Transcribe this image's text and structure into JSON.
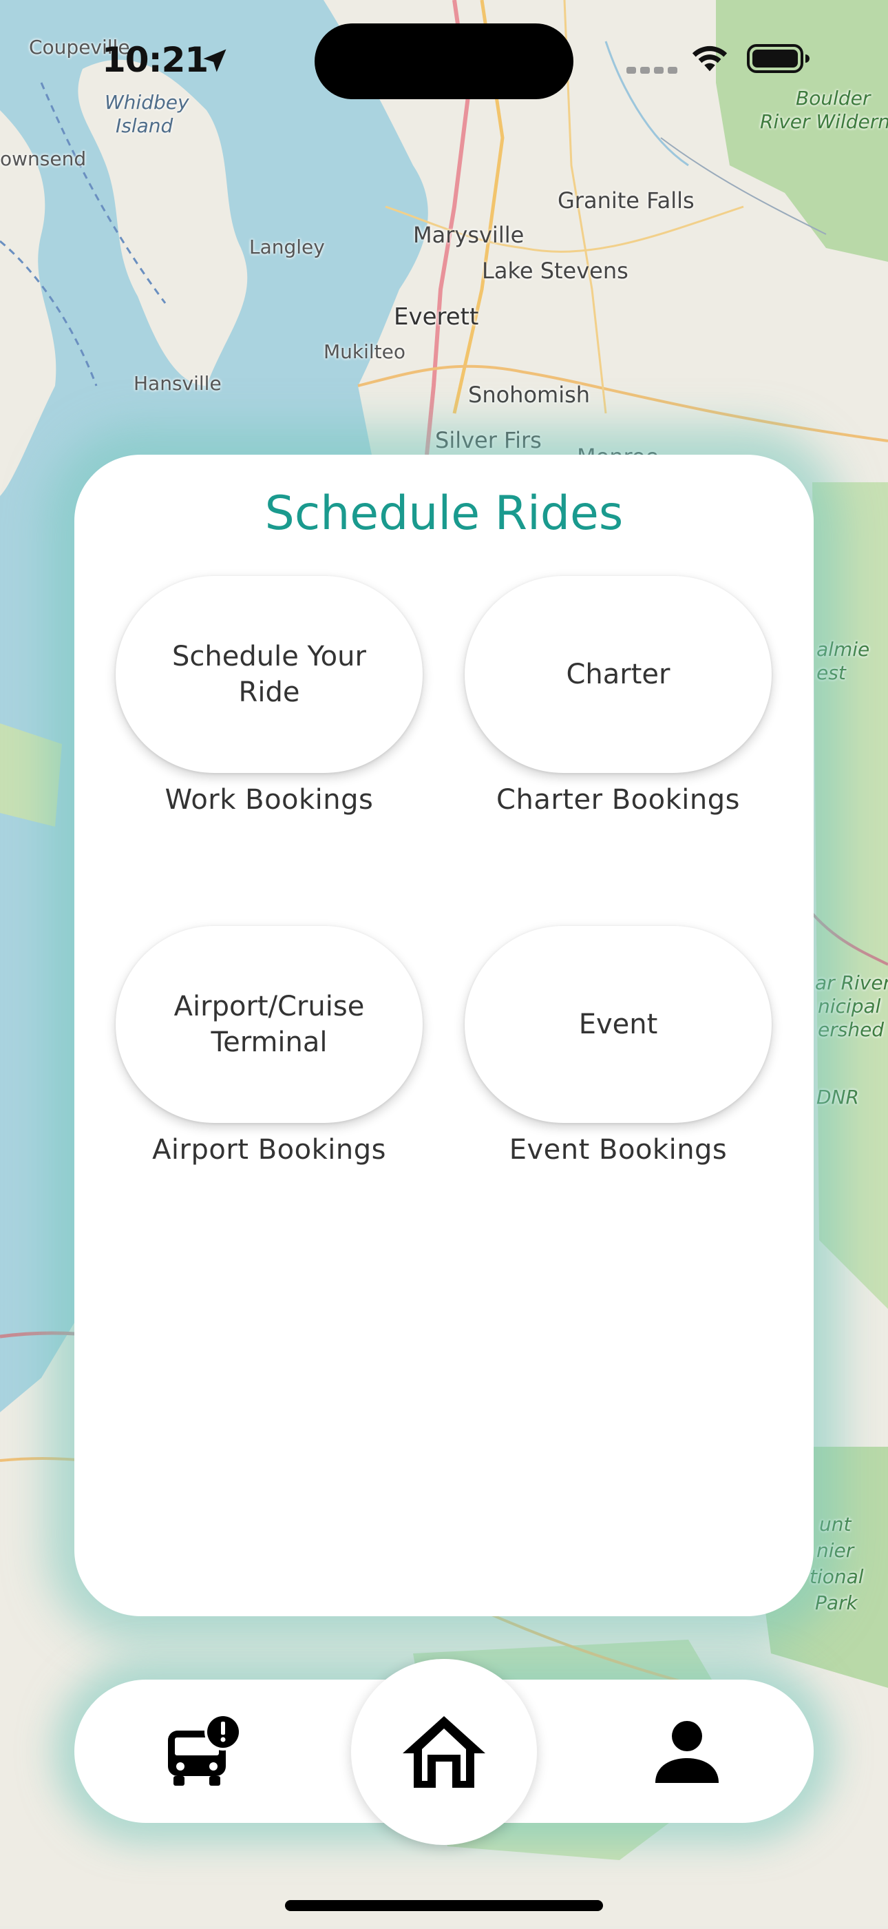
{
  "status_bar": {
    "time": "10:21",
    "location_icon": "location-arrow-icon",
    "signal_icon": "cellular-signal-icon",
    "wifi_icon": "wifi-icon",
    "battery_icon": "battery-icon"
  },
  "map": {
    "labels": {
      "coupeville": "Coupeville",
      "whidbey": "Whidbey",
      "island": "Island",
      "townsend": "ownsend",
      "langley": "Langley",
      "marysville": "Marysville",
      "granite_falls": "Granite Falls",
      "lake_stevens": "Lake Stevens",
      "everett": "Everett",
      "mukilteo": "Mukilteo",
      "hansville": "Hansville",
      "snohomish": "Snohomish",
      "silver_firs": "Silver Firs",
      "monroe": "Monroe",
      "boulder": "Boulder",
      "river_wilderness": "River Wilderne",
      "mount": "unt",
      "rainier": "nier",
      "national": "tional",
      "park": "Park",
      "dnr": "DNR",
      "ver_river": "ar River",
      "municipal": "nicipal",
      "watershed": "ershed",
      "almie": "almie",
      "est": "est"
    }
  },
  "card": {
    "title": "Schedule Rides",
    "options": [
      {
        "button_label": "Schedule Your Ride",
        "caption": "Work Bookings"
      },
      {
        "button_label": "Charter",
        "caption": "Charter Bookings"
      },
      {
        "button_label": "Airport/Cruise Terminal",
        "caption": "Airport Bookings"
      },
      {
        "button_label": "Event",
        "caption": "Event Bookings"
      }
    ]
  },
  "nav": {
    "items": [
      {
        "icon": "bus-alert-icon"
      },
      {
        "icon": "home-icon",
        "active": true
      },
      {
        "icon": "person-icon"
      }
    ]
  },
  "colors": {
    "accent": "#1a9a8e",
    "glow": "#78c8be"
  }
}
